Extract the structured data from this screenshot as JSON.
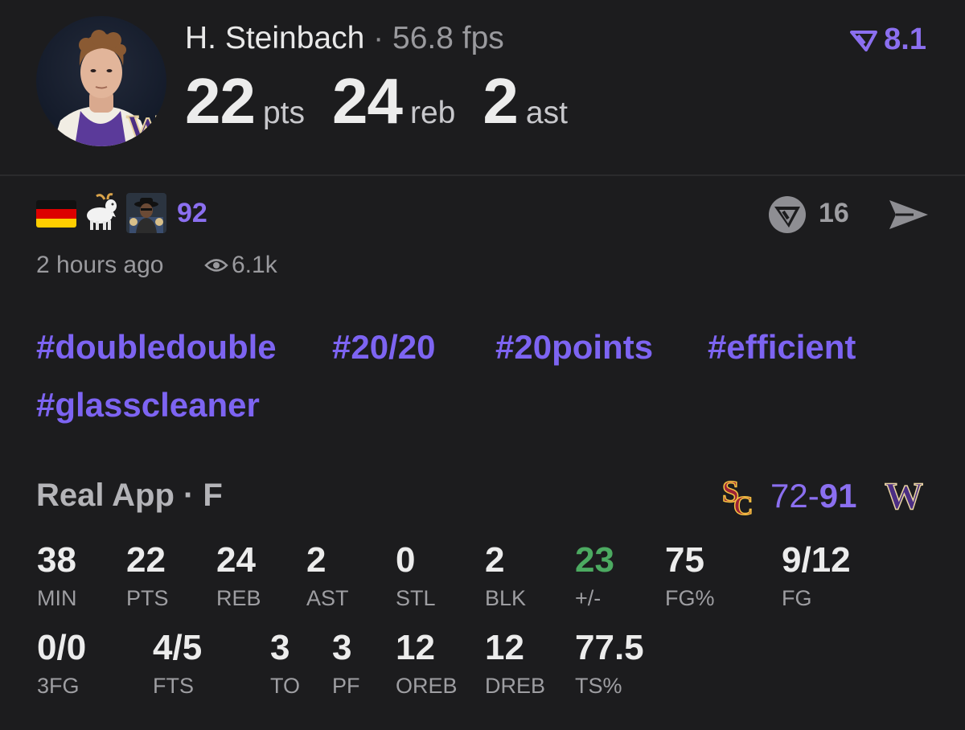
{
  "player": {
    "name": "H. Steinbach",
    "separator": "·",
    "fps": "56.8 fps",
    "rating": "8.1",
    "headline": [
      {
        "value": "22",
        "unit": "pts"
      },
      {
        "value": "24",
        "unit": "reb"
      },
      {
        "value": "2",
        "unit": "ast"
      }
    ]
  },
  "reactions": {
    "count": "92",
    "items": [
      "germany-flag-icon",
      "goat-icon",
      "meme-icon"
    ],
    "votes": "16",
    "time_ago": "2 hours ago",
    "views": "6.1k"
  },
  "hashtags": [
    "#doubledouble",
    "#20/20",
    "#20points",
    "#efficient",
    "#glasscleaner"
  ],
  "game": {
    "source": "Real App · F",
    "score_away": "72",
    "score_dash": "-",
    "score_home": "91"
  },
  "stats": [
    {
      "value": "38",
      "label": "MIN"
    },
    {
      "value": "22",
      "label": "PTS"
    },
    {
      "value": "24",
      "label": "REB"
    },
    {
      "value": "2",
      "label": "AST"
    },
    {
      "value": "0",
      "label": "STL"
    },
    {
      "value": "2",
      "label": "BLK"
    },
    {
      "value": "23",
      "label": "+/-"
    },
    {
      "value": "75",
      "label": "FG%"
    },
    {
      "value": "9/12",
      "label": "FG"
    },
    {
      "value": "0/0",
      "label": "3FG"
    },
    {
      "value": "4/5",
      "label": "FTS"
    },
    {
      "value": "3",
      "label": "TO"
    },
    {
      "value": "3",
      "label": "PF"
    },
    {
      "value": "12",
      "label": "OREB"
    },
    {
      "value": "12",
      "label": "DREB"
    },
    {
      "value": "77.5",
      "label": "TS%"
    }
  ],
  "colors": {
    "accent": "#8b6ff0",
    "positive": "#4caa61",
    "background": "#1c1c1e"
  }
}
